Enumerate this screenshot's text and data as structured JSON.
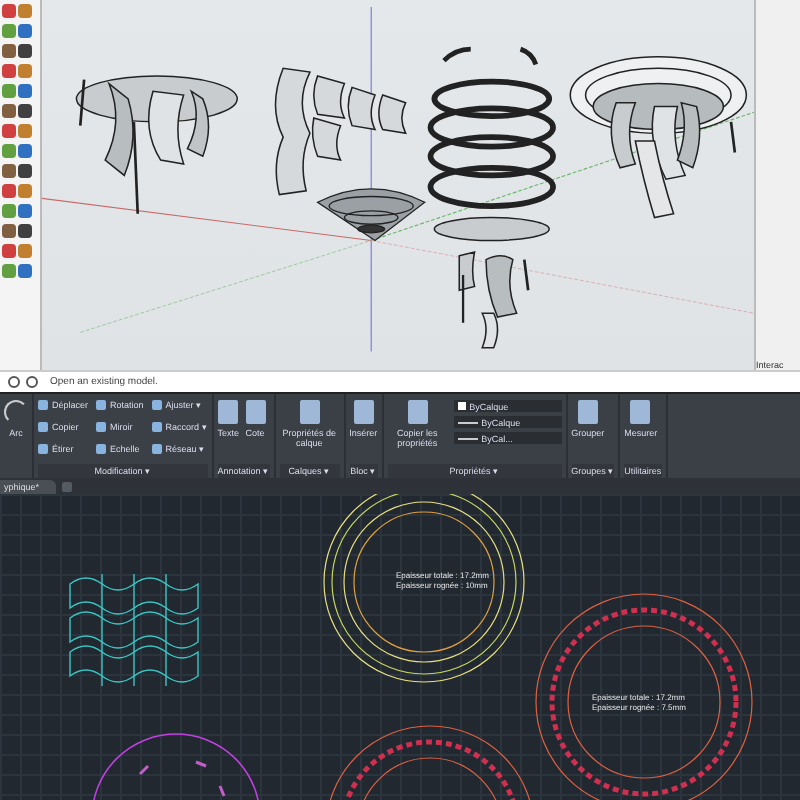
{
  "sketchup": {
    "status_text": "Open an existing model.",
    "panel_label": "Interac"
  },
  "ribbon": {
    "left_label": "Arc",
    "groups": [
      {
        "title": "Modification ▾",
        "kind": "grid",
        "tools": [
          "Déplacer",
          "Rotation",
          "Ajuster ▾",
          "Copier",
          "Miroir",
          "Raccord ▾",
          "Étirer",
          "Echelle",
          "Réseau ▾"
        ]
      },
      {
        "title": "Annotation ▾",
        "kind": "large",
        "tools": [
          "Texte",
          "Cote"
        ]
      },
      {
        "title": "Calques ▾",
        "kind": "large",
        "tools": [
          "Propriétés de calque"
        ]
      },
      {
        "title": "Bloc ▾",
        "kind": "large",
        "tools": [
          "Insérer"
        ]
      },
      {
        "title": "Propriétés ▾",
        "kind": "props",
        "tools": [
          "Copier les propriétés"
        ],
        "dropdowns": [
          "ByCalque",
          "ByCalque",
          "ByCal..."
        ]
      },
      {
        "title": "Groupes ▾",
        "kind": "large",
        "tools": [
          "Grouper"
        ]
      },
      {
        "title": "Utilitaires",
        "kind": "large",
        "tools": [
          "Mesurer"
        ]
      }
    ]
  },
  "file_tab": {
    "label": "yphique*"
  },
  "annotations": [
    {
      "lines": [
        "Epaisseur totale : 17.2mm",
        "Epaisseur rognée : 10mm"
      ]
    },
    {
      "lines": [
        "Epaisseur totale : 17.2mm",
        "Epaisseur rognée : 7.5mm"
      ]
    }
  ]
}
